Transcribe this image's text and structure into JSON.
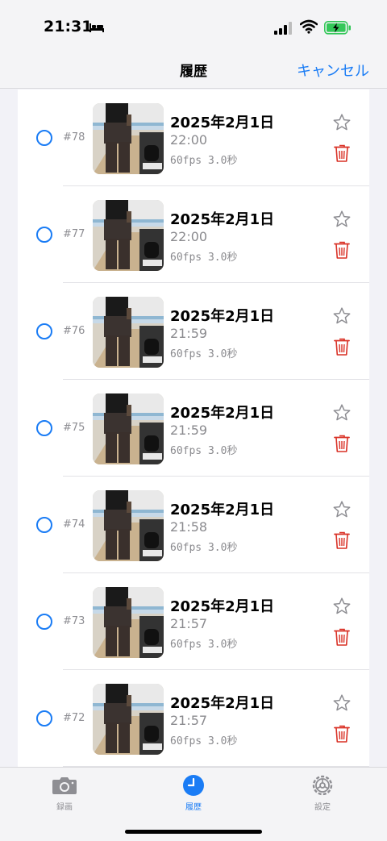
{
  "status": {
    "time": "21:31"
  },
  "nav": {
    "title": "履歴",
    "cancel_label": "キャンセル"
  },
  "colors": {
    "accent": "#1a7cf5",
    "delete": "#d93025",
    "background": "#f2f2f7"
  },
  "items": [
    {
      "index": "#78",
      "date": "2025年2月1日",
      "time": "22:00",
      "meta": "60fps 3.0秒"
    },
    {
      "index": "#77",
      "date": "2025年2月1日",
      "time": "22:00",
      "meta": "60fps 3.0秒"
    },
    {
      "index": "#76",
      "date": "2025年2月1日",
      "time": "21:59",
      "meta": "60fps 3.0秒"
    },
    {
      "index": "#75",
      "date": "2025年2月1日",
      "time": "21:59",
      "meta": "60fps 3.0秒"
    },
    {
      "index": "#74",
      "date": "2025年2月1日",
      "time": "21:58",
      "meta": "60fps 3.0秒"
    },
    {
      "index": "#73",
      "date": "2025年2月1日",
      "time": "21:57",
      "meta": "60fps 3.0秒"
    },
    {
      "index": "#72",
      "date": "2025年2月1日",
      "time": "21:57",
      "meta": "60fps 3.0秒"
    }
  ],
  "tabs": [
    {
      "label": "録画",
      "icon": "camera-icon"
    },
    {
      "label": "履歴",
      "icon": "clock-icon",
      "active": true
    },
    {
      "label": "設定",
      "icon": "gear-icon"
    }
  ]
}
